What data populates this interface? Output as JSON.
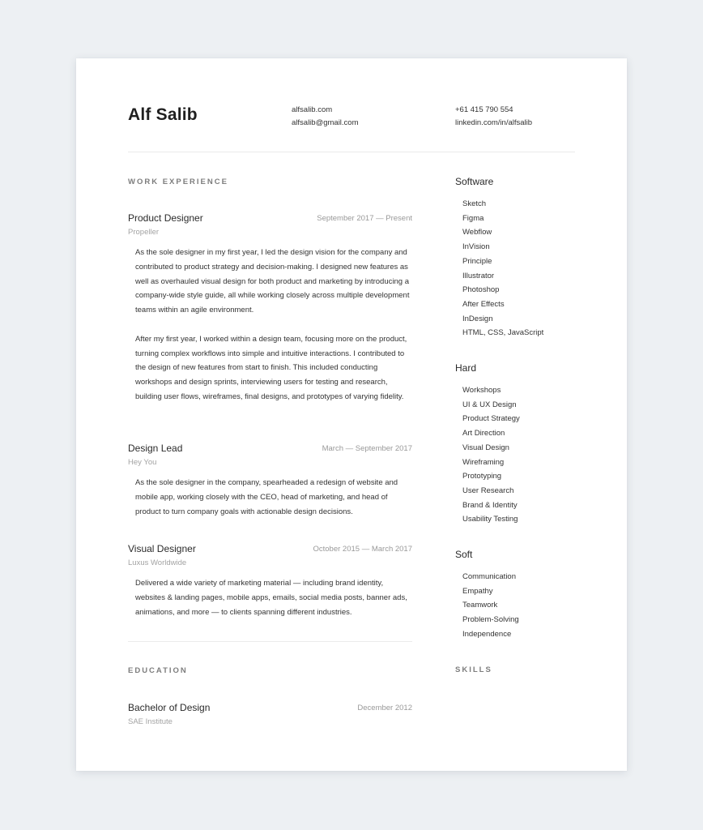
{
  "header": {
    "name": "Alf Salib",
    "website": "alfsalib.com",
    "email": "alfsalib@gmail.com",
    "phone": "+61 415 790 554",
    "linkedin": "linkedin.com/in/alfsalib"
  },
  "sections": {
    "work_experience": "WORK EXPERIENCE",
    "education": "EDUCATION",
    "skills": "SKILLS"
  },
  "jobs": [
    {
      "title": "Product Designer",
      "dates": "September 2017 — Present",
      "company": "Propeller",
      "paragraphs": [
        "As the sole designer in my first year, I led the design vision for the company and contributed to product strategy and decision-making. I designed new features as well as overhauled visual design for both product and marketing by introducing a company-wide style guide, all while working closely across multiple development teams within an agile environment.",
        "After my first year, I worked within a design team, focusing more on the product, turning complex workflows into simple and intuitive interactions. I contributed to the design of new features from start to finish. This included conducting workshops and design sprints, interviewing users for testing and research, building user flows, wireframes, final designs, and prototypes of varying fidelity."
      ]
    },
    {
      "title": "Design Lead",
      "dates": "March — September 2017",
      "company": "Hey You",
      "paragraphs": [
        "As the sole designer in the company, spearheaded a redesign of website and mobile app, working closely with the CEO, head of marketing, and head of product to turn company goals with actionable design decisions."
      ]
    },
    {
      "title": "Visual Designer",
      "dates": "October 2015 — March 2017",
      "company": "Luxus Worldwide",
      "paragraphs": [
        "Delivered a wide variety of marketing material — including brand identity, websites & landing pages, mobile apps, emails, social media posts, banner ads, animations, and more — to clients spanning different industries."
      ]
    }
  ],
  "education": [
    {
      "degree": "Bachelor of Design",
      "date": "December 2012",
      "institution": "SAE Institute"
    }
  ],
  "skills": {
    "software": {
      "title": "Software",
      "items": [
        "Sketch",
        "Figma",
        "Webflow",
        "InVision",
        "Principle",
        "Illustrator",
        "Photoshop",
        "After Effects",
        "InDesign",
        "HTML, CSS, JavaScript"
      ]
    },
    "hard": {
      "title": "Hard",
      "items": [
        "Workshops",
        "UI & UX Design",
        "Product Strategy",
        "Art Direction",
        "Visual Design",
        "Wireframing",
        "Prototyping",
        "User Research",
        "Brand & Identity",
        "Usability Testing"
      ]
    },
    "soft": {
      "title": "Soft",
      "items": [
        "Communication",
        "Empathy",
        "Teamwork",
        "Problem-Solving",
        "Independence"
      ]
    }
  },
  "colors": {
    "background": "#edf0f3",
    "page": "#ffffff",
    "text": "#222222",
    "muted": "#999999",
    "divider": "#ebebeb"
  }
}
